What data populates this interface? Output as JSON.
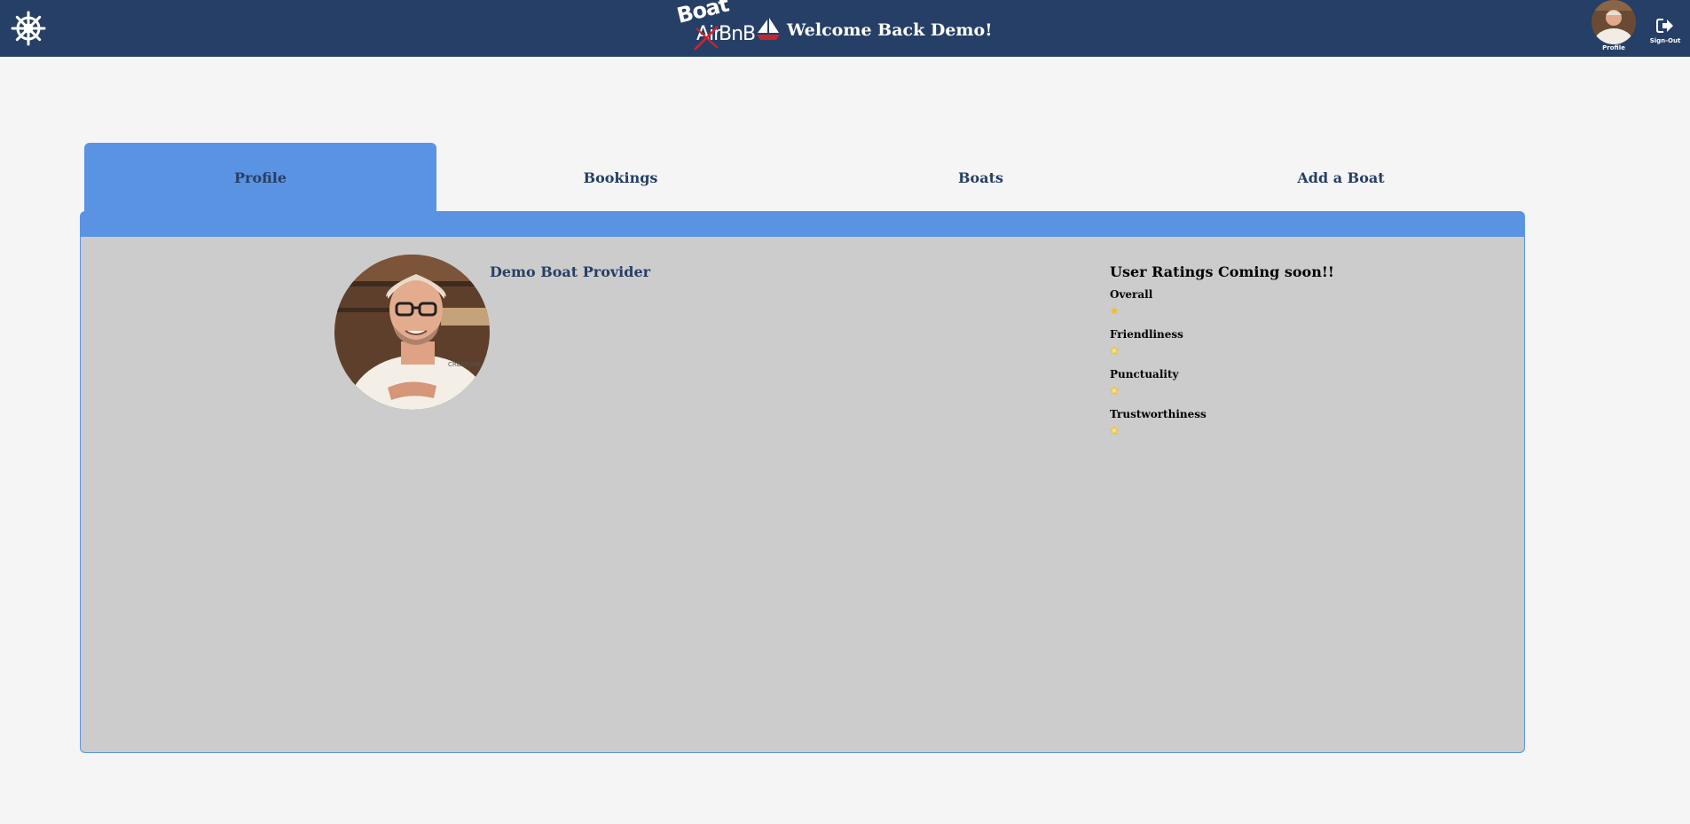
{
  "header": {
    "logo": {
      "boat": "Boat",
      "air": "Air",
      "bnb": "BnB"
    },
    "welcome": "Welcome Back Demo!",
    "profile_label": "Profile",
    "signout_label": "Sign-Out"
  },
  "tabs": [
    {
      "label": "Profile",
      "active": true
    },
    {
      "label": "Bookings",
      "active": false
    },
    {
      "label": "Boats",
      "active": false
    },
    {
      "label": "Add a Boat",
      "active": false
    }
  ],
  "profile": {
    "name": "Demo Boat Provider",
    "ratings_title": "User Ratings Coming soon!!",
    "ratings": [
      {
        "label": "Overall",
        "stars": 1,
        "filled": true
      },
      {
        "label": "Friendliness",
        "stars": 1,
        "filled": false
      },
      {
        "label": "Punctuality",
        "stars": 1,
        "filled": false
      },
      {
        "label": "Trustworthiness",
        "stars": 1,
        "filled": false
      }
    ]
  },
  "colors": {
    "navbar": "#263f66",
    "accent": "#5b93e3",
    "panel": "#cccccc",
    "star": "#f0c020"
  }
}
